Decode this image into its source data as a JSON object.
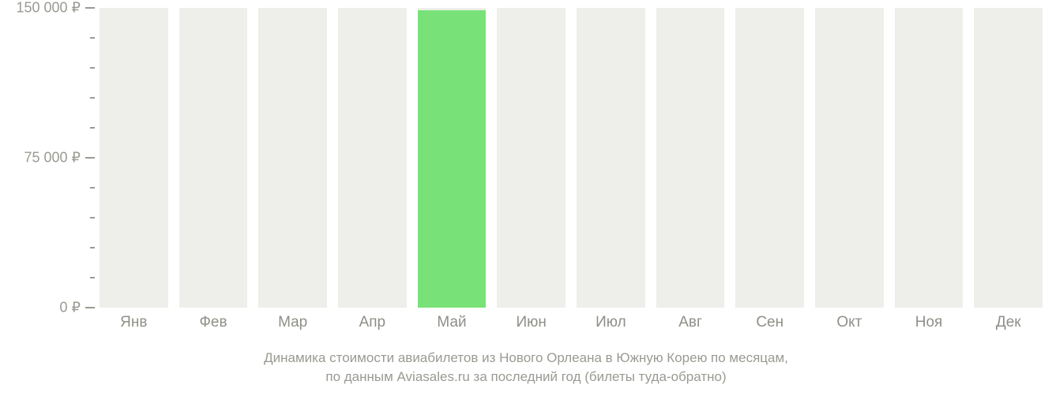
{
  "chart_data": {
    "type": "bar",
    "categories": [
      "Янв",
      "Фев",
      "Мар",
      "Апр",
      "Май",
      "Июн",
      "Июл",
      "Авг",
      "Сен",
      "Окт",
      "Ноя",
      "Дек"
    ],
    "values": [
      0,
      0,
      0,
      0,
      149000,
      0,
      0,
      0,
      0,
      0,
      0,
      0
    ],
    "ylim": [
      0,
      150000
    ],
    "y_ticks_major": [
      {
        "value": 0,
        "label": "0 ₽"
      },
      {
        "value": 75000,
        "label": "75 000 ₽"
      },
      {
        "value": 150000,
        "label": "150 000 ₽"
      }
    ],
    "y_minor_step": 15000,
    "caption_line1": "Динамика стоимости авиабилетов из Нового Орлеана в Южную Корею по месяцам,",
    "caption_line2": "по данным Aviasales.ru за последний год (билеты туда-обратно)",
    "bar_bg_color": "#eeeeea",
    "bar_value_color": "#78e278"
  }
}
